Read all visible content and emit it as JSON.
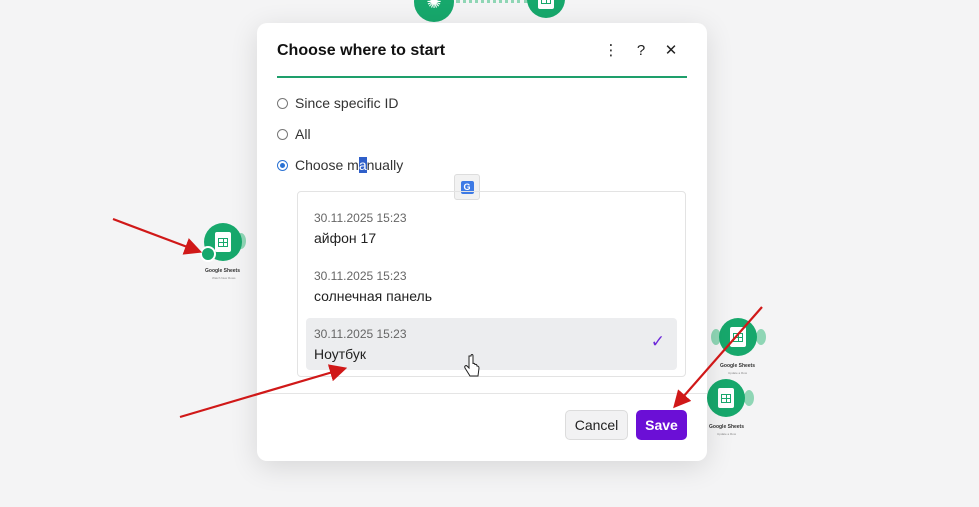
{
  "dialog": {
    "title": "Choose where to start",
    "options": [
      {
        "label_before": "Since specific ID",
        "label_sel": "",
        "label_after": "",
        "checked": false
      },
      {
        "label_before": "All",
        "label_sel": "",
        "label_after": "",
        "checked": false
      },
      {
        "label_before": "Choose m",
        "label_sel": "a",
        "label_after": "nually",
        "checked": true
      }
    ],
    "items": [
      {
        "date": "30.11.2025 15:23",
        "name": "айфон 17",
        "selected": false
      },
      {
        "date": "30.11.2025 15:23",
        "name": "солнечная панель",
        "selected": false
      },
      {
        "date": "30.11.2025 15:23",
        "name": "Ноутбук",
        "selected": true
      }
    ],
    "check_glyph": "✓",
    "cancel_label": "Cancel",
    "save_label": "Save"
  },
  "header_icons": [
    "more-vertical-icon",
    "help-icon",
    "close-icon"
  ],
  "background_nodes": [
    {
      "label": "Google Sheets",
      "sub": "Watch New Rows"
    },
    {
      "label": "Google Sheets",
      "sub": "Update a Row"
    },
    {
      "label": "Google Sheets",
      "sub": "Update a Row"
    }
  ],
  "colors": {
    "accent_green": "#1e9f6b",
    "save_purple": "#6b0fd6",
    "radio_blue": "#2a72d4",
    "arrow_red": "#d01818"
  }
}
